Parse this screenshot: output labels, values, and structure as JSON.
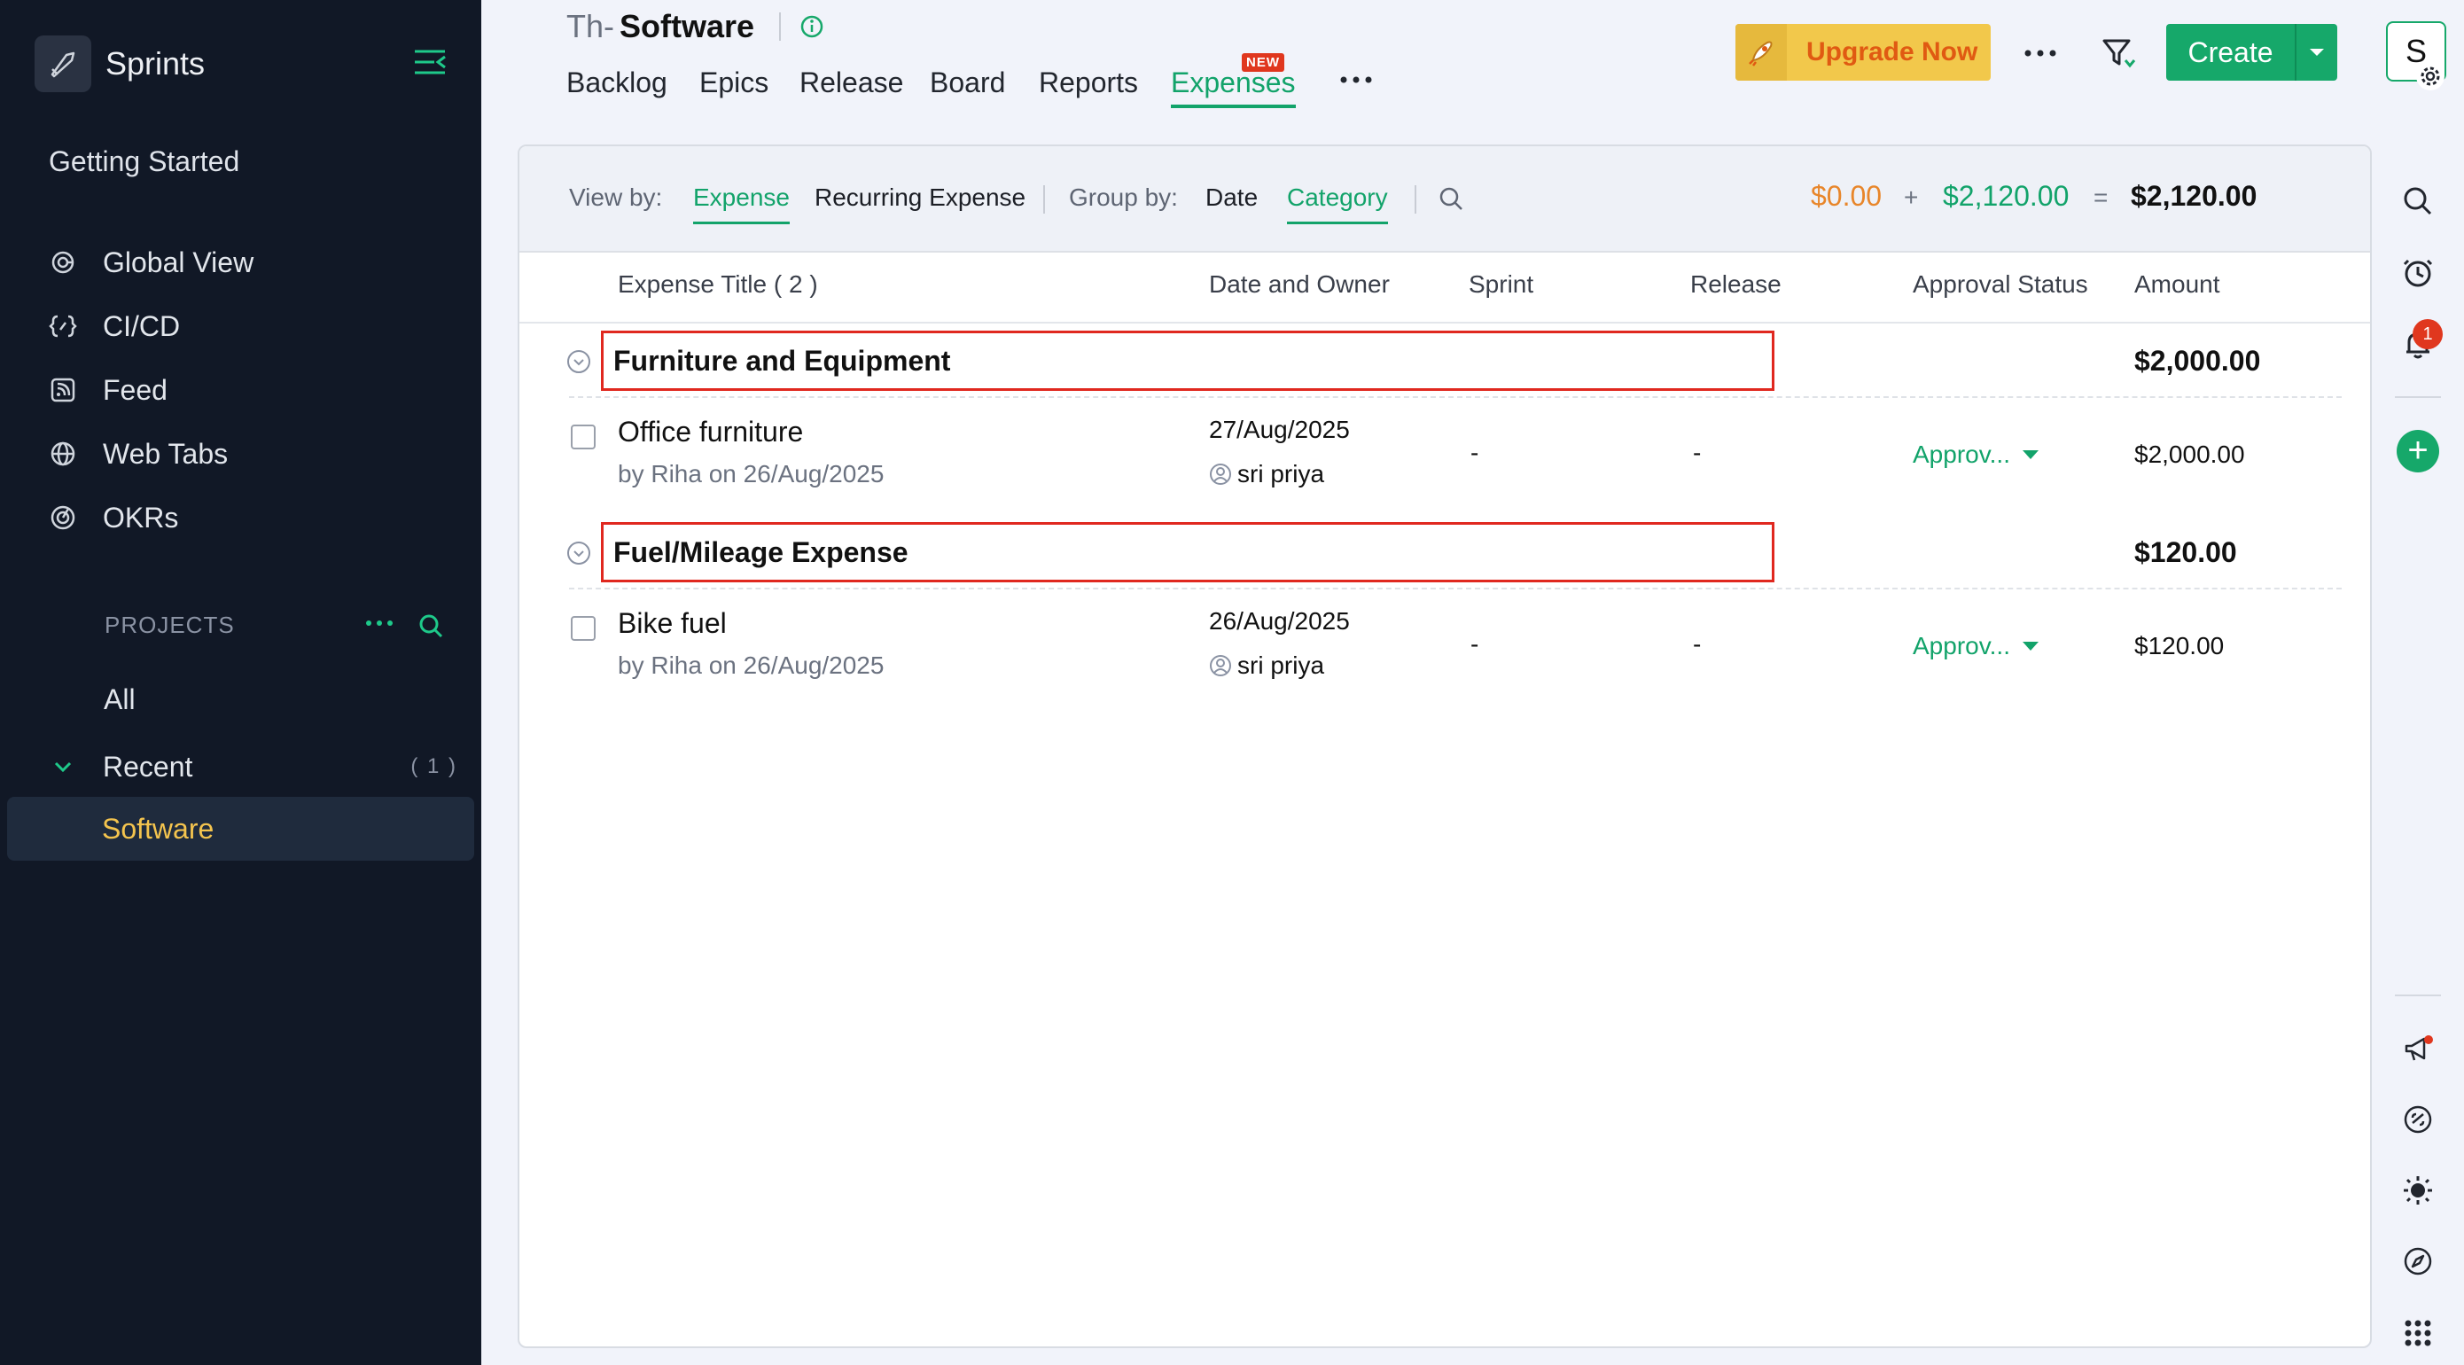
{
  "sidebar": {
    "app_name": "Sprints",
    "getting_started": "Getting Started",
    "nav": [
      {
        "label": "Global View",
        "icon": "global-view-icon"
      },
      {
        "label": "CI/CD",
        "icon": "cicd-icon"
      },
      {
        "label": "Feed",
        "icon": "feed-icon"
      },
      {
        "label": "Web Tabs",
        "icon": "web-tabs-icon"
      },
      {
        "label": "OKRs",
        "icon": "okrs-icon"
      }
    ],
    "projects_label": "PROJECTS",
    "all_label": "All",
    "recent_label": "Recent",
    "recent_count": "( 1 )",
    "current_project": "Software"
  },
  "header": {
    "prefix": "Th-",
    "project_name": "Software",
    "tabs": [
      "Backlog",
      "Epics",
      "Release",
      "Board",
      "Reports",
      "Expenses"
    ],
    "active_tab": "Expenses",
    "new_badge": "NEW",
    "upgrade_label": "Upgrade Now",
    "create_label": "Create",
    "avatar_initial": "S"
  },
  "toolbar": {
    "view_by_label": "View by:",
    "view_expense": "Expense",
    "view_recurring": "Recurring Expense",
    "group_by_label": "Group by:",
    "group_date": "Date",
    "group_category": "Category",
    "sum_pending": "$0.00",
    "sum_plus": "+",
    "sum_approved": "$2,120.00",
    "sum_equals": "=",
    "sum_total": "$2,120.00"
  },
  "columns": {
    "title": "Expense Title ( 2 )",
    "date_owner": "Date and Owner",
    "sprint": "Sprint",
    "release": "Release",
    "approval": "Approval Status",
    "amount": "Amount"
  },
  "groups": [
    {
      "name": "Furniture and Equipment",
      "amount": "$2,000.00",
      "item": {
        "title": "Office furniture",
        "by": "by Riha on 26/Aug/2025",
        "date": "27/Aug/2025",
        "owner": "sri priya",
        "sprint": "-",
        "release": "-",
        "status": "Approv...",
        "amount": "$2,000.00"
      }
    },
    {
      "name": "Fuel/Mileage Expense",
      "amount": "$120.00",
      "item": {
        "title": "Bike fuel",
        "by": "by Riha on 26/Aug/2025",
        "date": "26/Aug/2025",
        "owner": "sri priya",
        "sprint": "-",
        "release": "-",
        "status": "Approv...",
        "amount": "$120.00"
      }
    }
  ],
  "rail": {
    "notification_count": "1"
  },
  "colors": {
    "accent": "#16a86a",
    "sidebar_bg": "#111826",
    "highlight_box": "#e0281f",
    "upgrade_bg": "#f2c84b"
  }
}
